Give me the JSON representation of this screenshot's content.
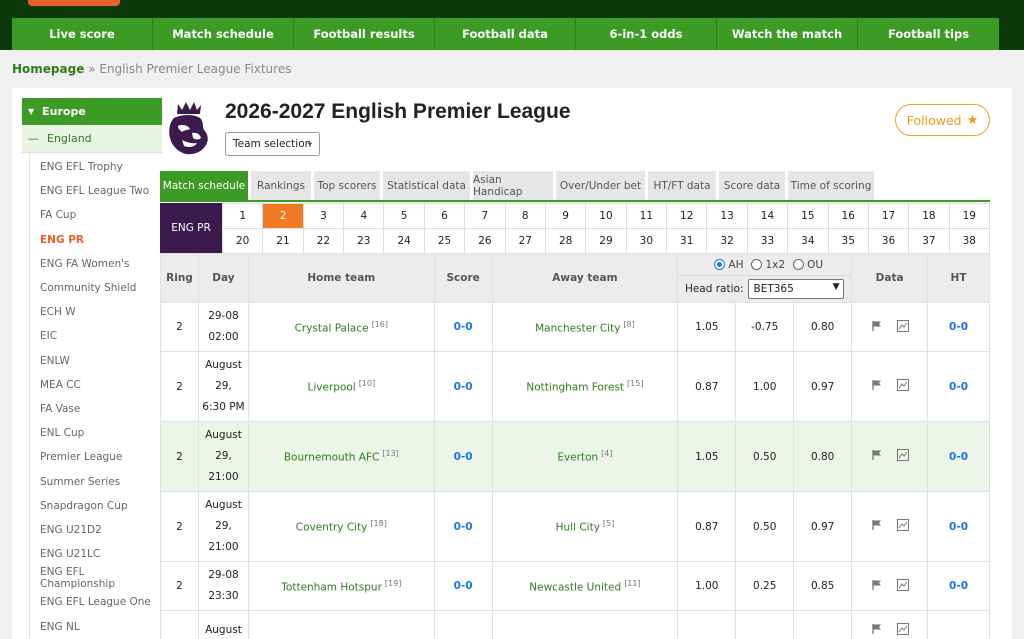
{
  "nav": [
    "Live score",
    "Match schedule",
    "Football results",
    "Football data",
    "6-in-1 odds",
    "Watch the match",
    "Football tips"
  ],
  "breadcrumb": {
    "home": "Homepage",
    "sep": "»",
    "current": "English Premier League Fixtures"
  },
  "sidebar": {
    "region": "Europe",
    "country": "England",
    "items": [
      "ENG EFL Trophy",
      "ENG EFL League Two",
      "FA Cup",
      "ENG PR",
      "ENG FA Women's",
      "Community Shield",
      "ECH W",
      "EIC",
      "ENLW",
      "MEA CC",
      "FA Vase",
      "ENL Cup",
      "Premier League",
      "Summer Series",
      "Snapdragon Cup",
      "ENG U21D2",
      "ENG U21LC",
      "ENG EFL Championship",
      "ENG EFL League One",
      "ENG NL"
    ],
    "active": "ENG PR"
  },
  "header": {
    "title": "2026-2027 English Premier League",
    "team_select": "Team selection",
    "followed": "Followed"
  },
  "tabs": [
    "Match schedule",
    "Rankings",
    "Top scorers",
    "Statistical data",
    "Asian Handicap",
    "Over/Under bet",
    "HT/FT data",
    "Score data",
    "Time of scoring"
  ],
  "active_tab": "Match schedule",
  "rounds": {
    "label": "ENG PR",
    "active": "2",
    "row1": [
      "1",
      "2",
      "3",
      "4",
      "5",
      "6",
      "7",
      "8",
      "9",
      "10",
      "11",
      "12",
      "13",
      "14",
      "15",
      "16",
      "17",
      "18",
      "19"
    ],
    "row2": [
      "20",
      "21",
      "22",
      "23",
      "24",
      "25",
      "26",
      "27",
      "28",
      "29",
      "30",
      "31",
      "32",
      "33",
      "34",
      "35",
      "36",
      "37",
      "38"
    ]
  },
  "table": {
    "headers": {
      "ring": "Ring",
      "day": "Day",
      "home": "Home team",
      "score": "Score",
      "away": "Away team",
      "data": "Data",
      "ht": "HT"
    },
    "odds": {
      "ah": "AH",
      "x12": "1x2",
      "ou": "OU",
      "ratio_label": "Head ratio:",
      "ratio_value": "BET365"
    },
    "rows": [
      {
        "ring": "2",
        "day": [
          "29-08",
          "02:00"
        ],
        "home": "Crystal Palace",
        "home_rank": "[16]",
        "score": "0-0",
        "away": "Manchester City",
        "away_rank": "[8]",
        "o1": "1.05",
        "o2": "-0.75",
        "o3": "0.80",
        "ht": "0-0"
      },
      {
        "ring": "2",
        "day": [
          "August",
          "29,",
          "6:30 PM"
        ],
        "home": "Liverpool",
        "home_rank": "[10]",
        "score": "0-0",
        "away": "Nottingham Forest",
        "away_rank": "[15]",
        "o1": "0.87",
        "o2": "1.00",
        "o3": "0.97",
        "ht": "0-0"
      },
      {
        "ring": "2",
        "day": [
          "August",
          "29,",
          "21:00"
        ],
        "home": "Bournemouth AFC",
        "home_rank": "[13]",
        "score": "0-0",
        "away": "Everton",
        "away_rank": "[4]",
        "o1": "1.05",
        "o2": "0.50",
        "o3": "0.80",
        "ht": "0-0"
      },
      {
        "ring": "2",
        "day": [
          "August",
          "29,",
          "21:00"
        ],
        "home": "Coventry City",
        "home_rank": "[18]",
        "score": "0-0",
        "away": "Hull City",
        "away_rank": "[5]",
        "o1": "0.87",
        "o2": "0.50",
        "o3": "0.97",
        "ht": "0-0"
      },
      {
        "ring": "2",
        "day": [
          "29-08",
          "23:30"
        ],
        "home": "Tottenham Hotspur",
        "home_rank": "[19]",
        "score": "0-0",
        "away": "Newcastle United",
        "away_rank": "[11]",
        "o1": "1.00",
        "o2": "0.25",
        "o3": "0.85",
        "ht": "0-0"
      },
      {
        "ring": "",
        "day": [
          "August"
        ],
        "home": "",
        "home_rank": "",
        "score": "",
        "away": "",
        "away_rank": "",
        "o1": "",
        "o2": "",
        "o3": "",
        "ht": ""
      }
    ]
  },
  "colors": {
    "nav_green": "#3c9b25",
    "dark_green": "#0c3a0c",
    "accent_orange": "#f07a23",
    "score_blue": "#1a73e8",
    "round_label": "#3b1b4e"
  }
}
